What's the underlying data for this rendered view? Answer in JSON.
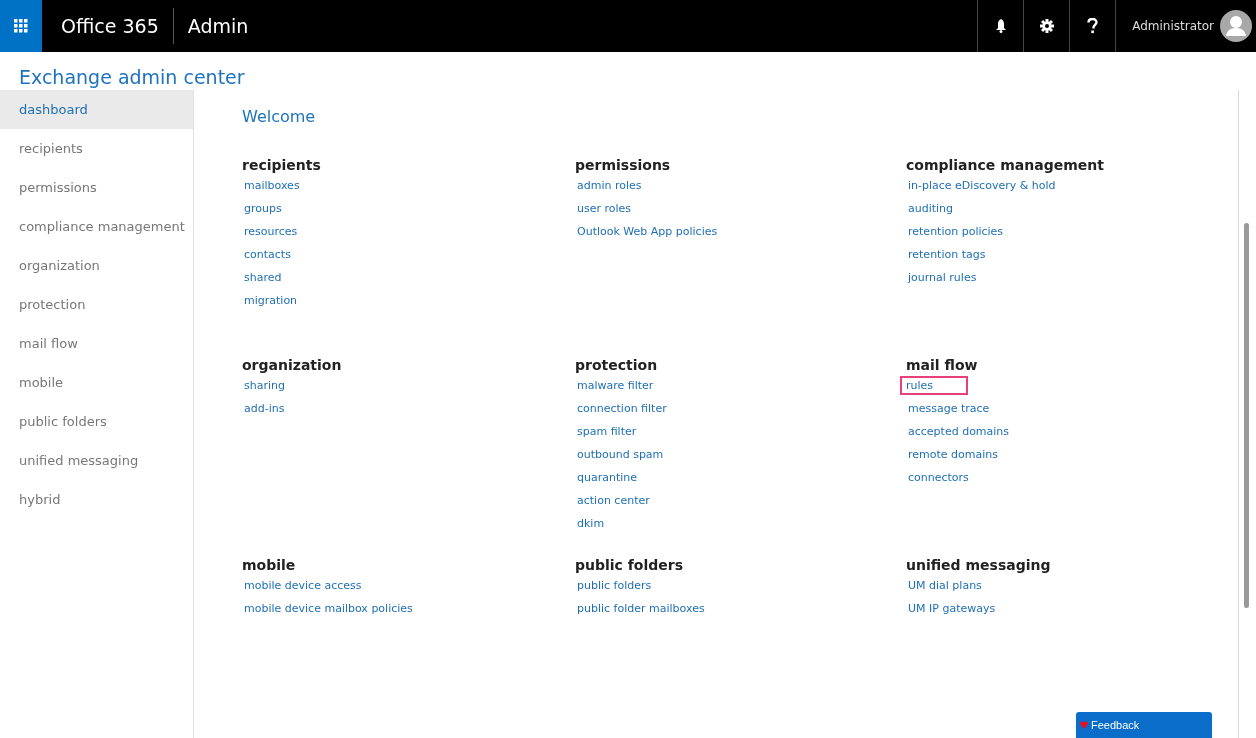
{
  "top_bar": {
    "app_name": "Office 365",
    "section": "Admin",
    "user": "Administrator"
  },
  "page_title": "Exchange admin center",
  "sidebar": {
    "items": [
      {
        "label": "dashboard",
        "selected": true
      },
      {
        "label": "recipients",
        "selected": false
      },
      {
        "label": "permissions",
        "selected": false
      },
      {
        "label": "compliance management",
        "selected": false
      },
      {
        "label": "organization",
        "selected": false
      },
      {
        "label": "protection",
        "selected": false
      },
      {
        "label": "mail flow",
        "selected": false
      },
      {
        "label": "mobile",
        "selected": false
      },
      {
        "label": "public folders",
        "selected": false
      },
      {
        "label": "unified messaging",
        "selected": false
      },
      {
        "label": "hybrid",
        "selected": false
      }
    ]
  },
  "main": {
    "heading": "Welcome",
    "sections": [
      {
        "title": "recipients",
        "links": [
          {
            "label": "mailboxes",
            "highlighted": false
          },
          {
            "label": "groups",
            "highlighted": false
          },
          {
            "label": "resources",
            "highlighted": false
          },
          {
            "label": "contacts",
            "highlighted": false
          },
          {
            "label": "shared",
            "highlighted": false
          },
          {
            "label": "migration",
            "highlighted": false
          }
        ]
      },
      {
        "title": "permissions",
        "links": [
          {
            "label": "admin roles",
            "highlighted": false
          },
          {
            "label": "user roles",
            "highlighted": false
          },
          {
            "label": "Outlook Web App policies",
            "highlighted": false
          }
        ]
      },
      {
        "title": "compliance management",
        "links": [
          {
            "label": "in-place eDiscovery & hold",
            "highlighted": false
          },
          {
            "label": "auditing",
            "highlighted": false
          },
          {
            "label": "retention policies",
            "highlighted": false
          },
          {
            "label": "retention tags",
            "highlighted": false
          },
          {
            "label": "journal rules",
            "highlighted": false
          }
        ]
      },
      {
        "title": "organization",
        "links": [
          {
            "label": "sharing",
            "highlighted": false
          },
          {
            "label": "add-ins",
            "highlighted": false
          }
        ]
      },
      {
        "title": "protection",
        "links": [
          {
            "label": "malware filter",
            "highlighted": false
          },
          {
            "label": "connection filter",
            "highlighted": false
          },
          {
            "label": "spam filter",
            "highlighted": false
          },
          {
            "label": "outbound spam",
            "highlighted": false
          },
          {
            "label": "quarantine",
            "highlighted": false
          },
          {
            "label": "action center",
            "highlighted": false
          },
          {
            "label": "dkim",
            "highlighted": false
          }
        ]
      },
      {
        "title": "mail flow",
        "links": [
          {
            "label": "rules",
            "highlighted": true
          },
          {
            "label": "message trace",
            "highlighted": false
          },
          {
            "label": "accepted domains",
            "highlighted": false
          },
          {
            "label": "remote domains",
            "highlighted": false
          },
          {
            "label": "connectors",
            "highlighted": false
          }
        ]
      },
      {
        "title": "mobile",
        "links": [
          {
            "label": "mobile device access",
            "highlighted": false
          },
          {
            "label": "mobile device mailbox policies",
            "highlighted": false
          }
        ]
      },
      {
        "title": "public folders",
        "links": [
          {
            "label": "public folders",
            "highlighted": false
          },
          {
            "label": "public folder mailboxes",
            "highlighted": false
          }
        ]
      },
      {
        "title": "unified messaging",
        "links": [
          {
            "label": "UM dial plans",
            "highlighted": false
          },
          {
            "label": "UM IP gateways",
            "highlighted": false
          }
        ]
      }
    ]
  },
  "feedback": {
    "label": "Feedback"
  }
}
